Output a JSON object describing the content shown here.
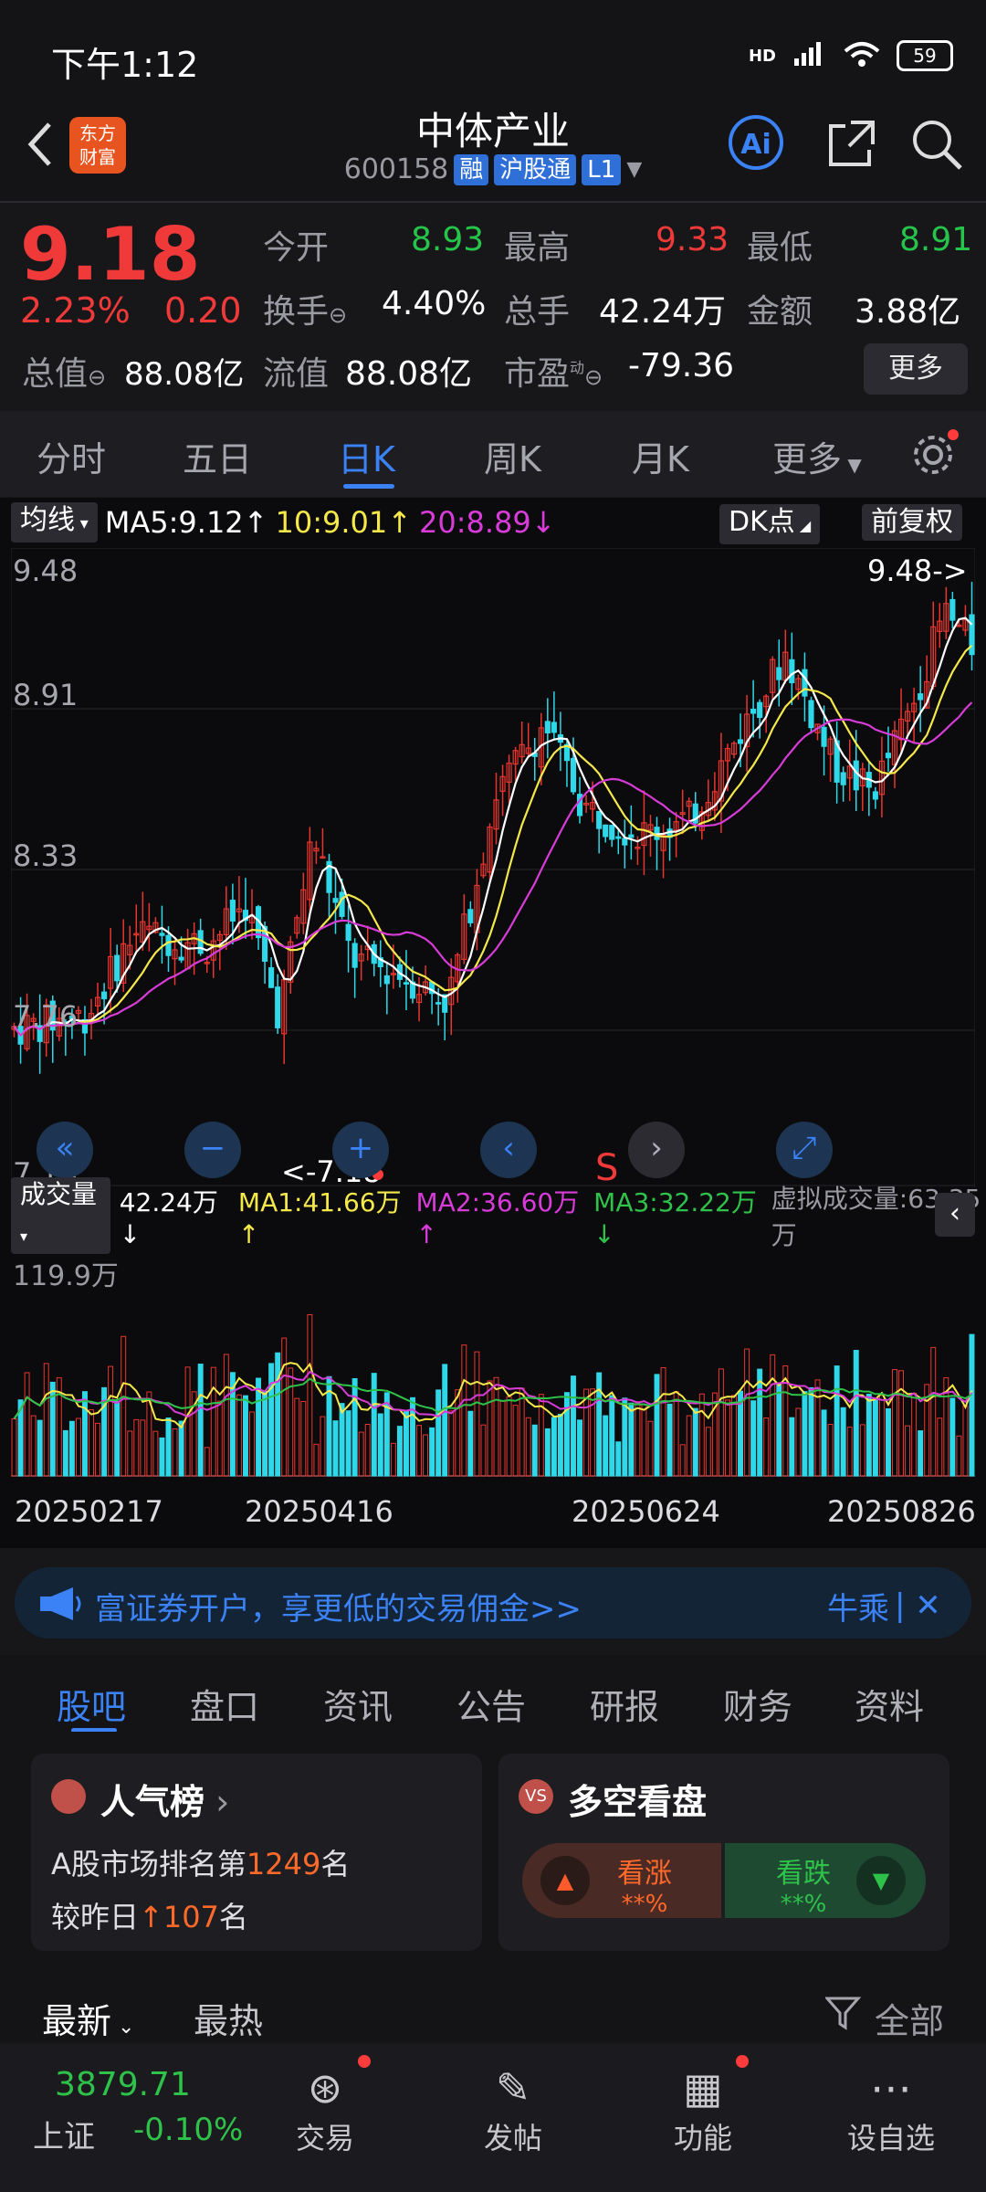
{
  "status": {
    "time": "下午1:12",
    "battery": "59",
    "net": "HD"
  },
  "header": {
    "logo_line1": "东方",
    "logo_line2": "财富",
    "stock_name": "中体产业",
    "code": "600158",
    "tags": [
      "融",
      "沪股通",
      "L1"
    ],
    "ai": "Ai"
  },
  "quote": {
    "price": "9.18",
    "pct": "2.23%",
    "change": "0.20",
    "open_label": "今开",
    "open": "8.93",
    "high_label": "最高",
    "high": "9.33",
    "low_label": "最低",
    "low": "8.91",
    "turnover_label": "换手",
    "turnover": "4.40%",
    "vol_label": "总手",
    "vol": "42.24万",
    "amount_label": "金额",
    "amount": "3.88亿",
    "mcap_label": "总值",
    "mcap": "88.08亿",
    "float_label": "流值",
    "float": "88.08亿",
    "pe_label": "市盈",
    "pe_sup": "动",
    "pe": "-79.36",
    "more": "更多"
  },
  "tabs": [
    "分时",
    "五日",
    "日K",
    "周K",
    "月K",
    "更多"
  ],
  "chart": {
    "ma_btn": "均线",
    "ma5": "MA5:9.12",
    "ma10": "10:9.01",
    "ma20": "20:8.89",
    "dk": "DK点",
    "fq": "前复权",
    "y_labels": [
      "9.48",
      "8.91",
      "8.33",
      "7.76",
      "7.18"
    ],
    "max_tag": "9.48->",
    "min_tag": "<-7.18",
    "s_mark": "S",
    "vol_btn": "成交量",
    "vol": "42.24万",
    "vma1": "MA1:41.66万",
    "vma2": "MA2:36.60万",
    "vma3": "MA3:32.22万",
    "virtual": "虚拟成交量:63.35万",
    "vol_max": "119.9万",
    "dates": [
      "20250217",
      "20250416",
      "20250624",
      "20250826"
    ],
    "colors": {
      "up": "#e8362f",
      "down": "#2fd8e8",
      "ma5": "#ffffff",
      "ma10": "#f5e84a",
      "ma20": "#d83cd8",
      "ma3": "#2fc24a"
    }
  },
  "banner": {
    "text": "富证券开户，享更低的交易佣金>>",
    "right": "牛乘"
  },
  "panel_tabs": [
    "股吧",
    "盘口",
    "资讯",
    "公告",
    "研报",
    "财务",
    "资料"
  ],
  "popular": {
    "title": "人气榜",
    "line1_pre": "A股市场排名第",
    "rank": "1249",
    "line1_post": "名",
    "line2_pre": "较昨日",
    "delta": "107",
    "line2_post": "名"
  },
  "longshort": {
    "title": "多空看盘",
    "up": "看涨",
    "down": "看跌",
    "masked": "**%"
  },
  "feed": {
    "latest": "最新",
    "hot": "最热",
    "all": "全部"
  },
  "nav": {
    "index_val": "3879.71",
    "index_name": "上证",
    "index_chg": "-0.10%",
    "items": [
      "交易",
      "发帖",
      "功能",
      "设自选"
    ]
  }
}
